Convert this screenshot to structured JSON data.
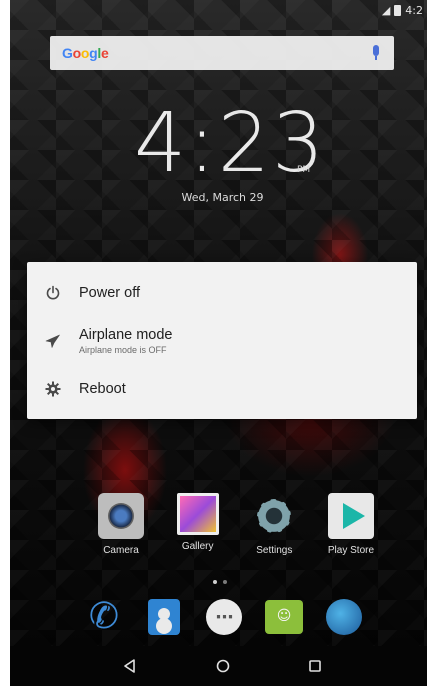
{
  "status_bar": {
    "time": "4:2"
  },
  "search": {
    "brand": [
      "G",
      "o",
      "o",
      "g",
      "l",
      "e"
    ]
  },
  "lockscreen": {
    "time": "4:23",
    "ampm": "PM",
    "date": "Wed, March 29"
  },
  "apps": [
    {
      "label": "Camera",
      "icon": "camera-icon"
    },
    {
      "label": "Gallery",
      "icon": "gallery-icon"
    },
    {
      "label": "Settings",
      "icon": "settings-icon"
    },
    {
      "label": "Play Store",
      "icon": "play-store-icon"
    }
  ],
  "dock": [
    "phone-icon",
    "contacts-icon",
    "app-drawer-icon",
    "messaging-icon",
    "browser-icon"
  ],
  "power_menu": {
    "items": [
      {
        "title": "Power off",
        "subtitle": "",
        "icon": "power-icon"
      },
      {
        "title": "Airplane mode",
        "subtitle": "Airplane mode is OFF",
        "icon": "airplane-icon"
      },
      {
        "title": "Reboot",
        "subtitle": "",
        "icon": "reboot-icon"
      }
    ]
  },
  "navigation": [
    "back-icon",
    "home-icon",
    "recents-icon"
  ],
  "colors": {
    "dialog_bg": "#f2f2f2",
    "text_primary": "#212121",
    "text_secondary": "#6b6b6b"
  }
}
